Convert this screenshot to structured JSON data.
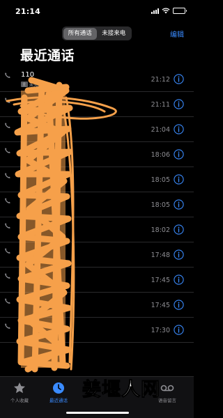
{
  "status_bar": {
    "time": "21:14"
  },
  "header": {
    "segments": [
      "所有通话",
      "未接来电"
    ],
    "active_segment": 0,
    "edit_label": "编辑",
    "title": "最近通话"
  },
  "calls": [
    {
      "name": "110",
      "subtitle": "未知",
      "sim": "主",
      "time": "21:12"
    },
    {
      "name": "",
      "subtitle": "",
      "sim": "",
      "time": "21:11"
    },
    {
      "name": "",
      "subtitle": "",
      "sim": "",
      "time": "21:04"
    },
    {
      "name": "",
      "subtitle": "",
      "sim": "",
      "time": "18:06"
    },
    {
      "name": "",
      "subtitle": "",
      "sim": "",
      "time": "18:05"
    },
    {
      "name": "",
      "subtitle": "",
      "sim": "",
      "time": "18:05"
    },
    {
      "name": "",
      "subtitle": "",
      "sim": "",
      "time": "18:02"
    },
    {
      "name": "",
      "subtitle": "",
      "sim": "",
      "time": "17:48"
    },
    {
      "name": "",
      "subtitle": "",
      "sim": "",
      "time": "17:45"
    },
    {
      "name": "",
      "subtitle": "",
      "sim": "",
      "time": "17:45"
    },
    {
      "name": "",
      "subtitle": "",
      "sim": "",
      "time": "17:30"
    }
  ],
  "tab_bar": {
    "tabs": [
      {
        "label": "个人收藏",
        "icon": "star-icon",
        "active": false
      },
      {
        "label": "最近通话",
        "icon": "clock-icon",
        "active": true
      },
      {
        "label": "语音留言",
        "icon": "voicemail-icon",
        "active": false
      }
    ]
  },
  "watermark": {
    "text": "姜堰人网"
  },
  "colors": {
    "accent": "#3a8bff",
    "scribble": "#f5a04a",
    "secondary_text": "#8e8e93"
  }
}
